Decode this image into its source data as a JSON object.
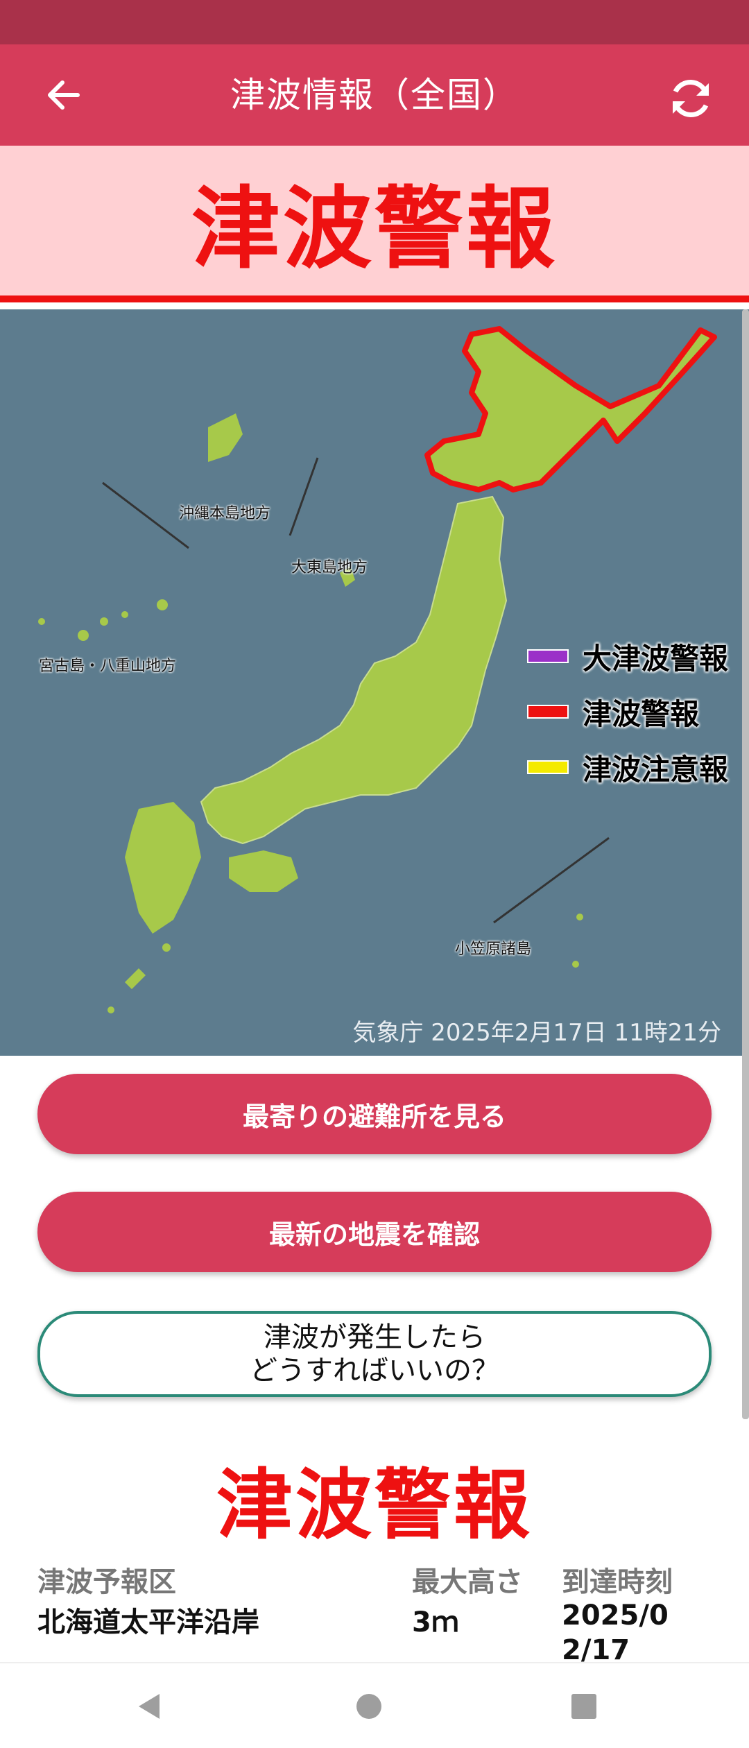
{
  "app_bar": {
    "title": "津波情報（全国）"
  },
  "alert": {
    "banner_text": "津波警報",
    "color": "#ee1111"
  },
  "map": {
    "labels": {
      "okinawa": "沖縄本島地方",
      "daito": "大東島地方",
      "miyako": "宮古島・八重山地方",
      "ogasawara": "小笠原諸島"
    },
    "legend": [
      {
        "label": "大津波警報",
        "color": "#9b30c8"
      },
      {
        "label": "津波警報",
        "color": "#ee1111"
      },
      {
        "label": "津波注意報",
        "color": "#f4ea00"
      }
    ],
    "attribution": "気象庁 2025年2月17日 11時21分"
  },
  "buttons": {
    "shelter": "最寄りの避難所を見る",
    "earthquake": "最新の地震を確認",
    "howto_line1": "津波が発生したら",
    "howto_line2": "どうすればいいの？"
  },
  "detail": {
    "title": "津波警報",
    "headers": {
      "area": "津波予報区",
      "height": "最大高さ",
      "arrival": "到達時刻"
    },
    "rows": [
      {
        "area": "北海道太平洋沿岸",
        "height": "3ｍ",
        "arrival_line1": "2025/0",
        "arrival_line2": "2/17"
      }
    ]
  },
  "colors": {
    "accent": "#d63c5a",
    "status_bar": "#a9314a",
    "sea": "#5d7c8e",
    "land": "#a7c94a"
  }
}
